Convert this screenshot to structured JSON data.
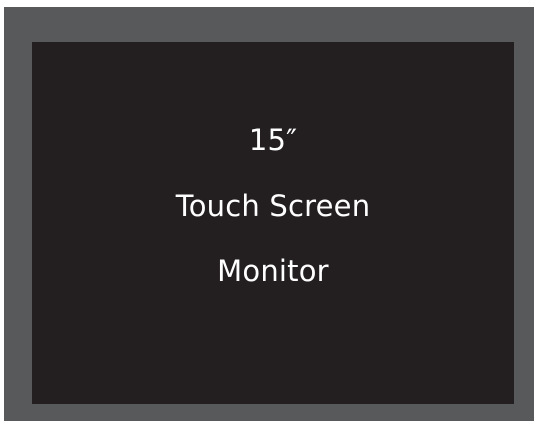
{
  "screen": {
    "lines": [
      "15″",
      "Touch Screen",
      "Monitor"
    ]
  },
  "colors": {
    "bezel": "#58595b",
    "screen": "#231f20",
    "text": "#ffffff"
  }
}
